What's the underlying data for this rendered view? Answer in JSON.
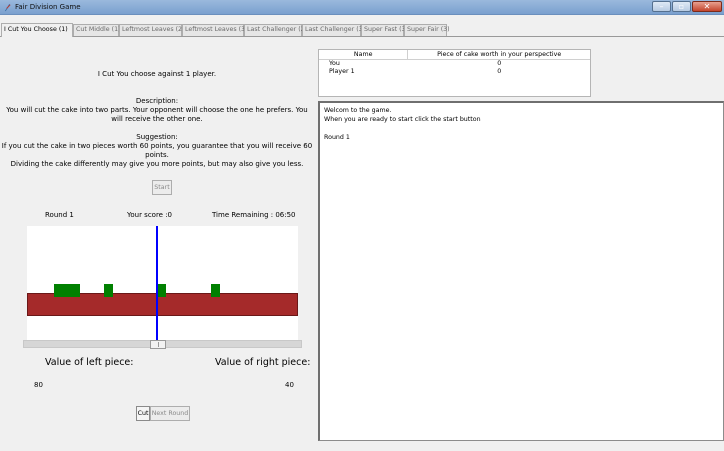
{
  "window": {
    "title": "Fair Division Game"
  },
  "tabs": [
    "I Cut You Choose (1)",
    "Cut Middle (1)",
    "Leftmost Leaves (2)",
    "Leftmost Leaves (3)",
    "Last Challenger (2)",
    "Last Challenger (3)",
    "Super Fast (3)",
    "Super Fair (3)"
  ],
  "game": {
    "heading": "I Cut You choose against 1 player.",
    "description_title": "Description:",
    "description_1": "You will cut the cake into two parts. Your opponent will choose the one he prefers. You",
    "description_2": "will receive the other one.",
    "suggestion_title": "Suggestion:",
    "suggestion_1": "If you cut the cake in two pieces worth 60 points, you guarantee that you will receive 60",
    "suggestion_2": "points.",
    "suggestion_3": "Dividing the cake differently may give you more points, but may also give you less.",
    "start_label": "Start",
    "round": "Round 1",
    "score": "Your score :0",
    "time": "Time Remaining : 06:50",
    "slider_position": 0.48,
    "left_label": "Value of left piece:",
    "right_label": "Value of right piece:",
    "left_value": "80",
    "right_value": "40",
    "cut_label": "Cut",
    "next_round_label": "Next Round"
  },
  "table": {
    "columns": [
      "Name",
      "Piece of cake worth in your perspective"
    ],
    "rows": [
      {
        "name": "You",
        "value": "0"
      },
      {
        "name": "Player 1",
        "value": "0"
      }
    ]
  },
  "log": {
    "lines": [
      "Welcom to the game.",
      "When you are ready to start click the start button",
      "",
      "Round 1"
    ]
  },
  "colors": {
    "cake": "#a52a2a",
    "berry": "#008000",
    "cut_line": "#0000ff"
  }
}
